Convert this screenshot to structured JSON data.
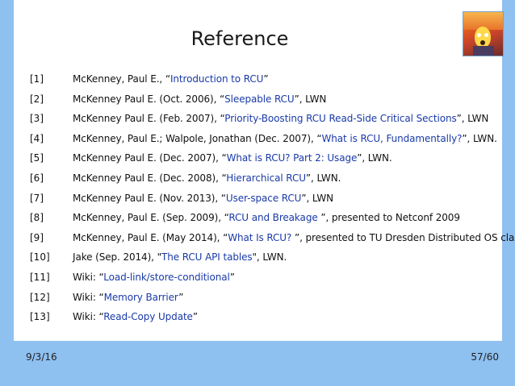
{
  "slide": {
    "title": "Reference",
    "footer": {
      "date": "9/3/16",
      "page": "57/60"
    },
    "references": [
      {
        "num": "[1]",
        "pre": "McKenney, Paul E., “",
        "link": "Introduction to RCU",
        "post": "”"
      },
      {
        "num": "[2]",
        "pre": "McKenney Paul E. (Oct. 2006), “",
        "link": "Sleepable RCU",
        "post": "”, LWN"
      },
      {
        "num": "[3]",
        "pre": "McKenney Paul E. (Feb. 2007), “",
        "link": "Priority-Boosting RCU Read-Side Critical Sections",
        "post": "”, LWN"
      },
      {
        "num": "[4]",
        "pre": "McKenney, Paul E.; Walpole, Jonathan  (Dec. 2007), “",
        "link": "What is RCU, Fundamentally?",
        "post": "”, LWN."
      },
      {
        "num": "[5]",
        "pre": "McKenney Paul E. (Dec. 2007), “",
        "link": "What is RCU? Part 2: Usage",
        "post": "”, LWN."
      },
      {
        "num": "[6]",
        "pre": "McKenney Paul E. (Dec. 2008), “",
        "link": "Hierarchical RCU",
        "post": "”, LWN."
      },
      {
        "num": "[7]",
        "pre": "McKenney Paul E. (Nov. 2013), “",
        "link": "User-space RCU",
        "post": "”, LWN"
      },
      {
        "num": "[8]",
        "pre": "McKenney, Paul E. (Sep. 2009), “",
        "link": "RCU and Breakage",
        "post": " ”, presented to Netconf 2009"
      },
      {
        "num": "[9]",
        "pre": "McKenney, Paul E. (May 2014), “",
        "link": "What Is RCU?",
        "post": " ”, presented to TU Dresden Distributed OS class"
      },
      {
        "num": "[10]",
        "pre": "Jake (Sep. 2014), \"",
        "link": "The RCU API tables",
        "post": "\", LWN."
      },
      {
        "num": "[11]",
        "pre": "Wiki: “",
        "link": "Load-link/store-conditional",
        "post": "”"
      },
      {
        "num": "[12]",
        "pre": "Wiki: “",
        "link": "Memory Barrier",
        "post": "”"
      },
      {
        "num": "[13]",
        "pre": "Wiki: “",
        "link": "Read-Copy Update",
        "post": "”"
      }
    ]
  },
  "colors": {
    "background": "#8ec0f0",
    "panel": "#ffffff",
    "link": "#1a3aa8"
  },
  "logo": {
    "icon": "scream-painting-logo"
  }
}
